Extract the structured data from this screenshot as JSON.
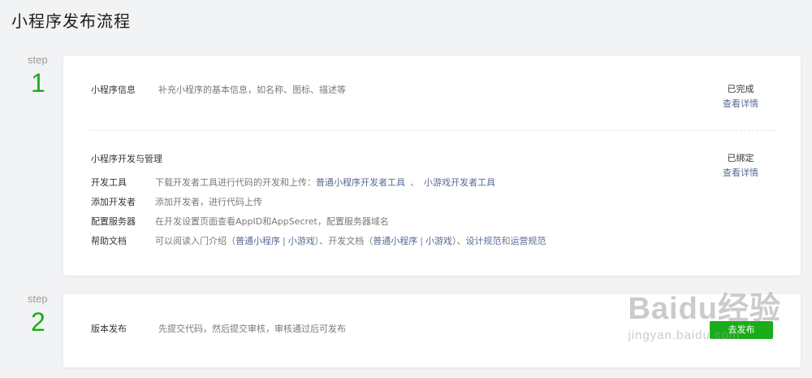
{
  "page": {
    "title": "小程序发布流程"
  },
  "steps": [
    {
      "label": "step",
      "number": "1"
    },
    {
      "label": "step",
      "number": "2"
    }
  ],
  "step1": {
    "info": {
      "label": "小程序信息",
      "desc": "补充小程序的基本信息，如名称、图标、描述等",
      "status": "已完成",
      "detail_link": "查看详情"
    },
    "dev": {
      "heading": "小程序开发与管理",
      "status": "已绑定",
      "detail_link": "查看详情",
      "rows": [
        {
          "label": "开发工具",
          "desc": "下载开发者工具进行代码的开发和上传：",
          "link1": "普通小程序开发者工具",
          "sep": "、",
          "link2": "小游戏开发者工具"
        },
        {
          "label": "添加开发者",
          "desc": "添加开发者，进行代码上传"
        },
        {
          "label": "配置服务器",
          "desc": "在开发设置页面查看AppID和AppSecret，配置服务器域名"
        },
        {
          "label": "帮助文档",
          "desc": "可以阅读入门介绍（",
          "link1": "普通小程序",
          "sep1": "|",
          "link2": "小游戏",
          "desc2": "）、开发文档（",
          "link3": "普通小程序",
          "sep2": "|",
          "link4": "小游戏",
          "desc3": "）、",
          "link5": "设计规范",
          "and": "和",
          "link6": "运营规范"
        }
      ]
    }
  },
  "step2": {
    "label": "版本发布",
    "desc": "先提交代码，然后提交审核，审核通过后可发布",
    "button_label": "去发布"
  },
  "watermark": {
    "logo": "Baidu经验",
    "sub": "jingyan.baidu.com"
  },
  "colors": {
    "accent_green": "#1aad19",
    "link_blue": "#576b95",
    "background": "#f2f3f5"
  }
}
